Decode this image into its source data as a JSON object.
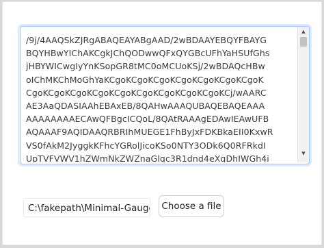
{
  "textarea": {
    "lines": [
      "/9j/4AAQSkZJRgABAQEAYABgAAD/2wBDAAYEBQYFBAYG",
      "BQYHBwYIChAKCgkJChQODwwQFxQYGBcUFhYaHSUfGhs",
      "jHBYWICwgIyYnKSopGR8tMC0oMCUoKSj/2wBDAQcHBw",
      "oIChMKChMoGhYaKCgoKCgoKCgoKCgoKCgoKCgoKCgoK",
      "CgoKCgoKCgoKCgoKCgoKCgoKCgoKCgoKCgoKCj/wAARC",
      "AE3AaQDASIAAhEBAxEB/8QAHwAAAQUBAQEBAQEAAA",
      "AAAAAAAAECAwQFBgcICQoL/8QAtRAAAgEDAwIEAwUFB",
      "AQAAAF9AQIDAAQRBRIhMUEGE1FhByJxFDKBkaEII0KxwR",
      "VS0fAkM2JyggkKFhcYGRolJicoKSo0NTY3ODk6Q0RFRkdI",
      "UpTVFVWV1hZWmNkZWZnaGlqc3R1dnd4eXqDhIWGh4i"
    ]
  },
  "file": {
    "path": "C:\\fakepath\\Minimal-Gauge",
    "button_label": "Choose a file"
  },
  "scrollbar": {
    "up_glyph": "▲",
    "down_glyph": "▼"
  }
}
